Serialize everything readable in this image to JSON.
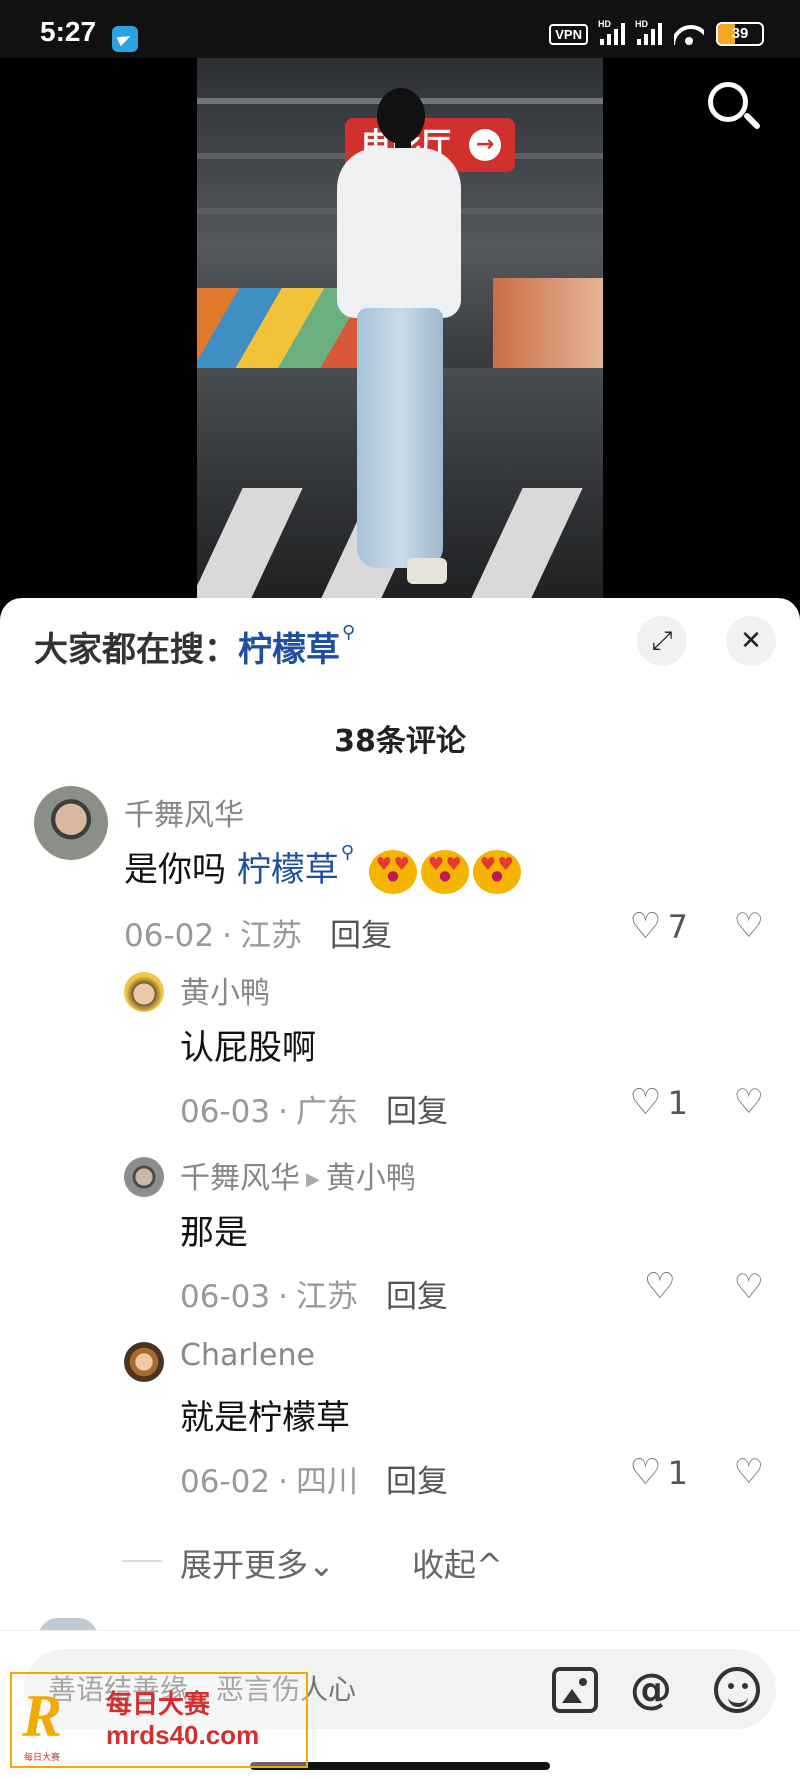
{
  "status_bar": {
    "time": "5:27",
    "vpn": "VPN",
    "hd": "HD",
    "battery": "39",
    "battery_level": 0.39,
    "battery_color": "#f5a623"
  },
  "video": {
    "sign_text": "电影厅",
    "sign_arrow": "→",
    "search_icon": "search-icon"
  },
  "panel": {
    "hot_search_prefix": "大家都在搜：",
    "hot_search_keyword": "柠檬草",
    "search_glyph": "⚲",
    "expand_icon": "⤢",
    "close_icon": "✕",
    "comment_count": "38条评论"
  },
  "comments": [
    {
      "user": "千舞风华",
      "text_prefix": "是你吗 ",
      "text_keyword": "柠檬草",
      "emoji_icon": "heart-eyes-emoji",
      "date": "06-02",
      "location": "江苏",
      "reply": "回复",
      "likes": "7"
    },
    {
      "user": "黄小鸭",
      "text": "认屁股啊",
      "date": "06-03",
      "location": "广东",
      "reply": "回复",
      "likes": "1"
    },
    {
      "user": "千舞风华",
      "reply_to": "黄小鸭",
      "text": "那是",
      "date": "06-03",
      "location": "江苏",
      "reply": "回复",
      "likes": ""
    },
    {
      "user": "Charlene",
      "text": "就是柠檬草",
      "date": "06-02",
      "location": "四川",
      "reply": "回复",
      "likes": "1"
    }
  ],
  "replies_controls": {
    "expand_more": "展开更多",
    "expand_chevron": "⌄",
    "collapse": "收起",
    "collapse_chevron": "^"
  },
  "input": {
    "placeholder": "善语结善缘，恶言伤人心",
    "at_symbol": "@"
  },
  "watermark": {
    "logo_letter": "R",
    "logo_caption": "每日大赛",
    "title": "每日大赛",
    "url": "mrds40.com"
  }
}
